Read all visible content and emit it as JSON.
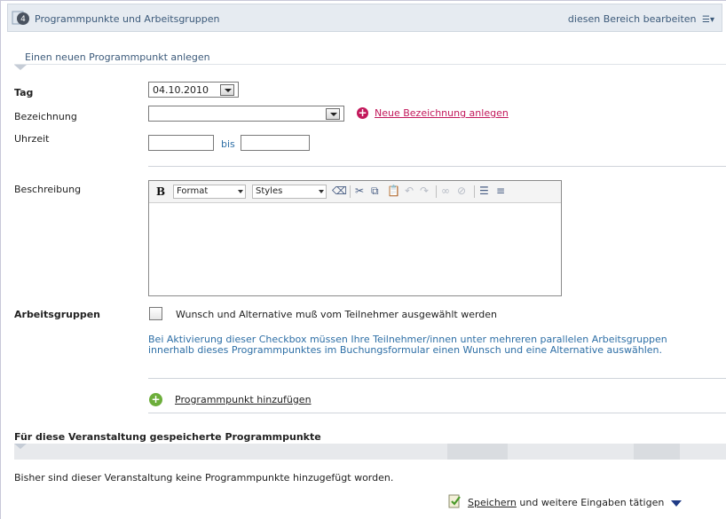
{
  "header": {
    "badge": "4",
    "title": "Programmpunkte und Arbeitsgruppen",
    "edit_label": "diesen Bereich bearbeiten"
  },
  "subheading": "Einen neuen Programmpunkt anlegen",
  "form": {
    "tag_label": "Tag",
    "tag_value": "04.10.2010",
    "bezeichnung_label": "Bezeichnung",
    "bezeichnung_value": "",
    "neue_bezeichnung_link": "Neue Bezeichnung anlegen",
    "uhrzeit_label": "Uhrzeit",
    "uhrzeit_from": "",
    "bis_label": "bis",
    "uhrzeit_to": "",
    "beschreibung_label": "Beschreibung",
    "editor": {
      "bold": "B",
      "format_label": "Format",
      "styles_label": "Styles",
      "content": ""
    },
    "arbeitsgruppen_label": "Arbeitsgruppen",
    "checkbox_label": "Wunsch und Alternative muß vom Teilnehmer ausgewählt werden",
    "checkbox_checked": false,
    "help_text": "Bei Aktivierung dieser Checkbox müssen Ihre Teilnehmer/innen unter mehreren parallelen Arbeitsgruppen innerhalb dieses Programmpunktes im Buchungsformular einen Wunsch und eine Alternative auswählen.",
    "add_button": "Programmpunkt hinzufügen"
  },
  "saved_section": {
    "title": "Für diese Veranstaltung gespeicherte Programmpunkte",
    "empty_text": "Bisher sind dieser Veranstaltung keine Programmpunkte hinzugefügt worden."
  },
  "footer": {
    "save_link": "Speichern",
    "save_rest": "und weitere Eingaben tätigen"
  },
  "colors": {
    "accent_pink": "#c2185b",
    "help_blue": "#2e6fa6",
    "header_bg": "#e6ebf1",
    "add_green": "#6cae3a"
  }
}
